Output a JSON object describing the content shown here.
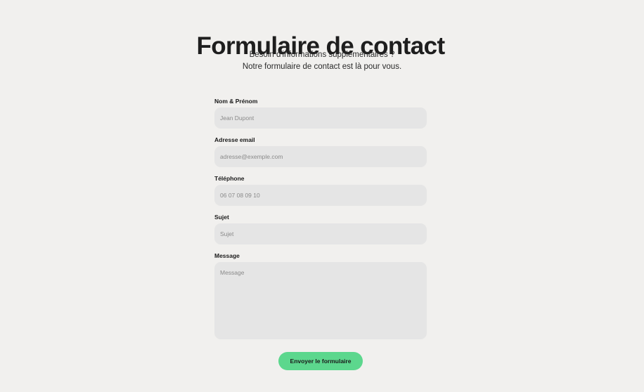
{
  "header": {
    "title": "Formulaire de contact",
    "subtitle_line1": "Besoin d'informations supplémentaires ?",
    "subtitle_line2": "Notre formulaire de contact est là pour vous."
  },
  "form": {
    "name": {
      "label": "Nom & Prénom",
      "placeholder": "Jean Dupont",
      "value": ""
    },
    "email": {
      "label": "Adresse email",
      "placeholder": "adresse@exemple.com",
      "value": ""
    },
    "phone": {
      "label": "Téléphone",
      "placeholder": "06 07 08 09 10",
      "value": ""
    },
    "subject": {
      "label": "Sujet",
      "placeholder": "Sujet",
      "value": ""
    },
    "message": {
      "label": "Message",
      "placeholder": "Message",
      "value": ""
    },
    "submit_label": "Envoyer le formulaire"
  },
  "colors": {
    "background": "#f1f0ee",
    "field_background": "#e5e5e5",
    "accent": "#5cd78d",
    "text": "#1e1e1e"
  }
}
